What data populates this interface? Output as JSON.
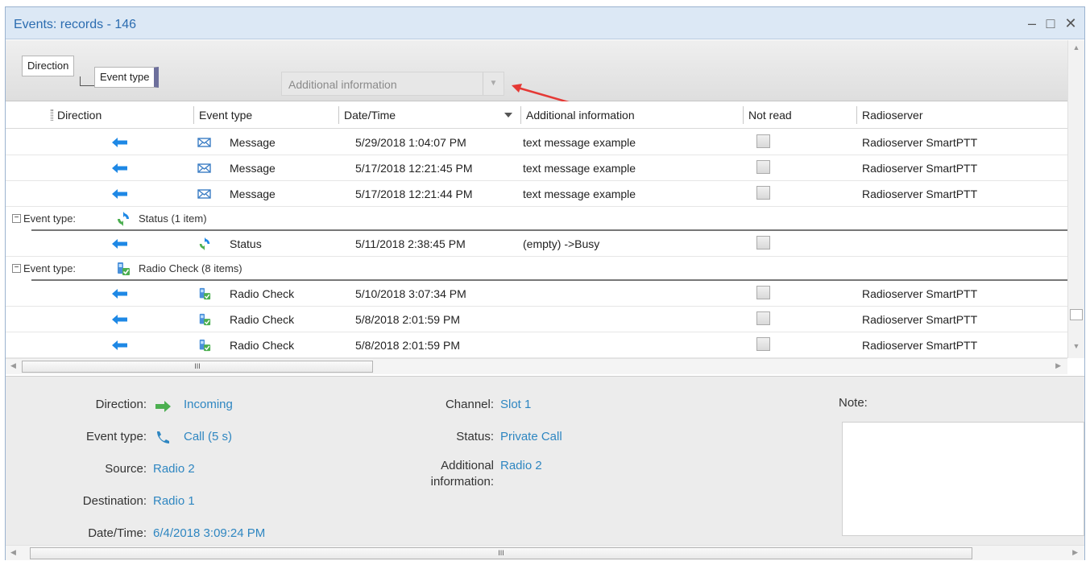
{
  "window": {
    "title": "Events: records - 146",
    "controls": {
      "minimize": "–",
      "maximize": "□",
      "close": "✕"
    }
  },
  "groupbar": {
    "chips": [
      "Direction",
      "Event type"
    ],
    "drop_field": {
      "label": "Additional information",
      "dropdown_icon": "chevron-down-icon"
    }
  },
  "columns": [
    "Direction",
    "Event type",
    "Date/Time",
    "Additional information",
    "Not read",
    "Radioserver"
  ],
  "sort": {
    "column": "Date/Time",
    "direction": "descending"
  },
  "colors": {
    "accent": "#2e86c1",
    "arrow_blue": "#1e88e5",
    "arrow_green": "#4caf50",
    "annotation_red": "#e53935"
  },
  "rows": [
    {
      "kind": "data",
      "direction": "outgoing",
      "icon": "envelope-icon",
      "event_type": "Message",
      "datetime": "5/29/2018 1:04:07 PM",
      "additional": "text message example",
      "not_read": false,
      "radioserver": "Radioserver SmartPTT"
    },
    {
      "kind": "data",
      "direction": "outgoing",
      "icon": "envelope-icon",
      "event_type": "Message",
      "datetime": "5/17/2018 12:21:45 PM",
      "additional": "text message example",
      "not_read": false,
      "radioserver": "Radioserver SmartPTT"
    },
    {
      "kind": "data",
      "direction": "outgoing",
      "icon": "envelope-icon",
      "event_type": "Message",
      "datetime": "5/17/2018 12:21:44 PM",
      "additional": "text message example",
      "not_read": false,
      "radioserver": "Radioserver SmartPTT"
    },
    {
      "kind": "group",
      "label": "Event type:",
      "icon": "status-refresh-icon",
      "text": "Status (1 item)"
    },
    {
      "kind": "data",
      "direction": "outgoing",
      "icon": "status-refresh-icon",
      "event_type": "Status",
      "datetime": "5/11/2018 2:38:45 PM",
      "additional": "(empty) ->Busy",
      "not_read": false,
      "radioserver": ""
    },
    {
      "kind": "group",
      "label": "Event type:",
      "icon": "radio-check-icon",
      "text": "Radio Check (8 items)"
    },
    {
      "kind": "data",
      "direction": "outgoing",
      "icon": "radio-check-icon",
      "event_type": "Radio Check",
      "datetime": "5/10/2018 3:07:34 PM",
      "additional": "",
      "not_read": false,
      "radioserver": "Radioserver SmartPTT"
    },
    {
      "kind": "data",
      "direction": "outgoing",
      "icon": "radio-check-icon",
      "event_type": "Radio Check",
      "datetime": "5/8/2018 2:01:59 PM",
      "additional": "",
      "not_read": false,
      "radioserver": "Radioserver SmartPTT"
    },
    {
      "kind": "data",
      "direction": "outgoing",
      "icon": "radio-check-icon",
      "event_type": "Radio Check",
      "datetime": "5/8/2018 2:01:59 PM",
      "additional": "",
      "not_read": false,
      "radioserver": "Radioserver SmartPTT"
    }
  ],
  "details": {
    "direction_label": "Direction:",
    "direction_value": "Incoming",
    "event_type_label": "Event type:",
    "event_type_value": "Call (5 s)",
    "source_label": "Source:",
    "source_value": "Radio 2",
    "destination_label": "Destination:",
    "destination_value": "Radio 1",
    "datetime_label": "Date/Time:",
    "datetime_value": "6/4/2018 3:09:24 PM",
    "channel_label": "Channel:",
    "channel_value": "Slot 1",
    "status_label": "Status:",
    "status_value": "Private Call",
    "additional_label_1": "Additional",
    "additional_label_2": "information:",
    "additional_value": "Radio 2",
    "note_label": "Note:",
    "note_value": ""
  },
  "scroll": {
    "grip": "III"
  }
}
